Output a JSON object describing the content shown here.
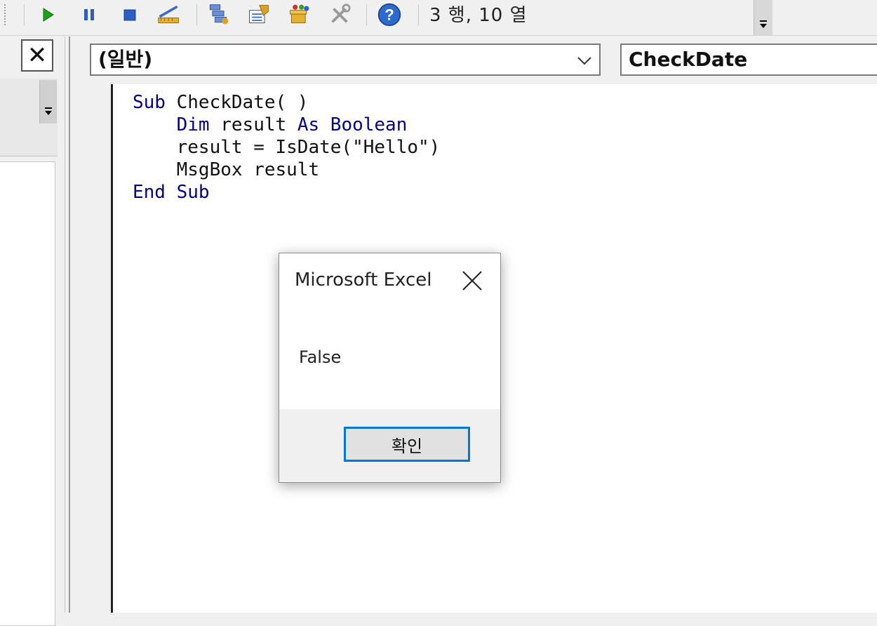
{
  "toolbar": {
    "icons": [
      "run-icon",
      "pause-icon",
      "stop-icon",
      "design-mode-icon",
      "project-explorer-icon",
      "properties-icon",
      "object-browser-icon",
      "toolbox-icon",
      "help-icon"
    ],
    "cursor_position": "3 행, 10 열"
  },
  "left_pane": {
    "close_symbol": "✕"
  },
  "code_window": {
    "object_combo": "(일반)",
    "procedure_combo": "CheckDate",
    "lines": [
      {
        "kw1": "Sub",
        "text1": " CheckDate( )"
      },
      {
        "indent": "    ",
        "kw1": "Dim",
        "text1": " result ",
        "kw2": "As Boolean"
      },
      {
        "indent": "    ",
        "text1": "result = IsDate(\"Hello\")"
      },
      {
        "indent": "    ",
        "text1": "MsgBox result"
      },
      {
        "kw1": "End Sub"
      }
    ]
  },
  "msgbox": {
    "title": "Microsoft Excel",
    "message": "False",
    "ok_label": "확인"
  },
  "colors": {
    "keyword": "#00008b",
    "accent": "#0078d7"
  }
}
